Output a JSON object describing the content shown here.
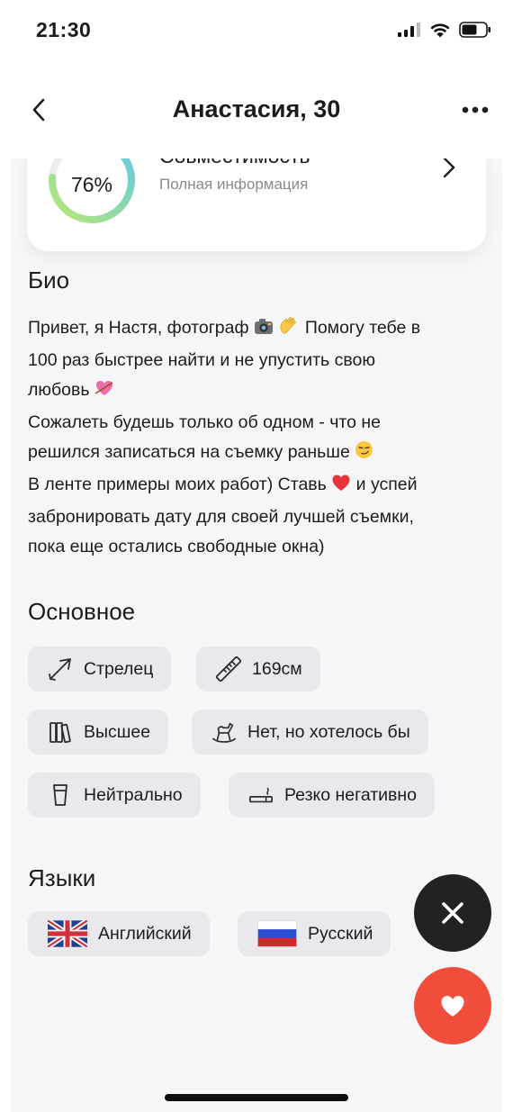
{
  "status_bar": {
    "time": "21:30"
  },
  "nav": {
    "title": "Анастасия, 30"
  },
  "compatibility": {
    "percent_label": "76%",
    "percent_value": 76,
    "title": "Совместимость",
    "subtitle": "Полная информация"
  },
  "bio": {
    "title": "Био",
    "lines": [
      "Привет, я Настя, фотограф",
      "Помогу тебе в",
      "100 раз быстрее найти и не упустить свою",
      "любовь",
      "Сожалеть будешь только об одном - что не",
      "решился записаться на съемку раньше",
      "В ленте примеры моих работ) Ставь",
      "и успей",
      "забронировать дату для своей лучшей съемки,",
      "пока еще остались свободные окна)"
    ]
  },
  "basics": {
    "title": "Основное",
    "chips": [
      {
        "icon": "arrow-icon",
        "label": "Стрелец"
      },
      {
        "icon": "ruler-icon",
        "label": "169см"
      },
      {
        "icon": "books-icon",
        "label": "Высшее"
      },
      {
        "icon": "rocking-horse-icon",
        "label": "Нет, но хотелось бы"
      },
      {
        "icon": "glass-icon",
        "label": "Нейтрально"
      },
      {
        "icon": "cigarette-icon",
        "label": "Резко негативно"
      }
    ]
  },
  "languages": {
    "title": "Языки",
    "items": [
      {
        "icon": "uk-flag-icon",
        "label": "Английский"
      },
      {
        "icon": "russia-flag-icon",
        "label": "Русский"
      }
    ]
  },
  "colors": {
    "accent_like": "#f04e3a",
    "close_bg": "#222222",
    "chip_bg": "#e8e8ed",
    "panel_bg": "#f6f6f8"
  }
}
